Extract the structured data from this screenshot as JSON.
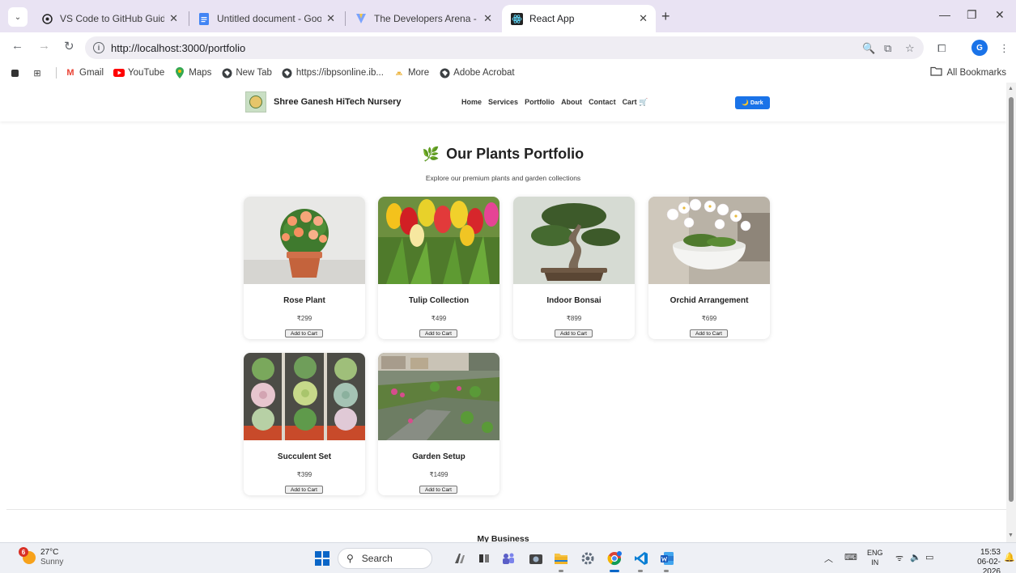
{
  "browser": {
    "tabs": [
      {
        "title": "VS Code to GitHub Guide",
        "active": false
      },
      {
        "title": "Untitled document - Google Do",
        "active": false
      },
      {
        "title": "The Developers Arena - Launch",
        "active": false
      },
      {
        "title": "React App",
        "active": true
      }
    ],
    "address": {
      "url": "http://localhost:3000/portfolio"
    },
    "bookmarks": [
      "Gmail",
      "YouTube",
      "Maps",
      "New Tab",
      "https://ibpsonline.ib...",
      "More",
      "Adobe Acrobat"
    ],
    "all_bookmarks": "All Bookmarks",
    "profile_initial": "G"
  },
  "site": {
    "brand": "Shree Ganesh HiTech Nursery",
    "nav": [
      "Home",
      "Services",
      "Portfolio",
      "About",
      "Contact",
      "Cart 🛒"
    ],
    "theme_toggle": "🌙 Dark",
    "accent_color": "#1a73e8"
  },
  "portfolio": {
    "title": "Our Plants Portfolio",
    "subtitle": "Explore our premium plants and garden collections",
    "add_to_cart_label": "Add to Cart",
    "products": [
      {
        "name": "Rose Plant",
        "price": "₹299"
      },
      {
        "name": "Tulip Collection",
        "price": "₹499"
      },
      {
        "name": "Indoor Bonsai",
        "price": "₹899"
      },
      {
        "name": "Orchid Arrangement",
        "price": "₹699"
      },
      {
        "name": "Succulent Set",
        "price": "₹399"
      },
      {
        "name": "Garden Setup",
        "price": "₹1499"
      }
    ]
  },
  "footer": {
    "title": "My Business"
  },
  "taskbar": {
    "weather_temp": "27°C",
    "weather_desc": "Sunny",
    "weather_badge": "6",
    "search_label": "Search",
    "language": "ENG",
    "region": "IN",
    "time": "15:53",
    "date": "06-02-2026"
  }
}
